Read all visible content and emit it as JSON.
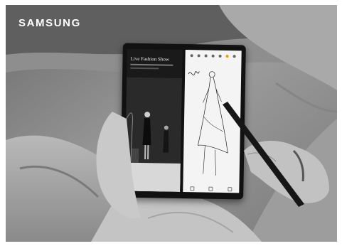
{
  "brand": {
    "logo_text": "SAMSUNG"
  },
  "device": {
    "left_screen": {
      "video_title": "Live Fashion Show"
    },
    "right_screen": {
      "app": "notes-sketch"
    }
  },
  "colors": {
    "background": "#7d7d7d",
    "logo": "#ffffff",
    "device": "#111111"
  }
}
